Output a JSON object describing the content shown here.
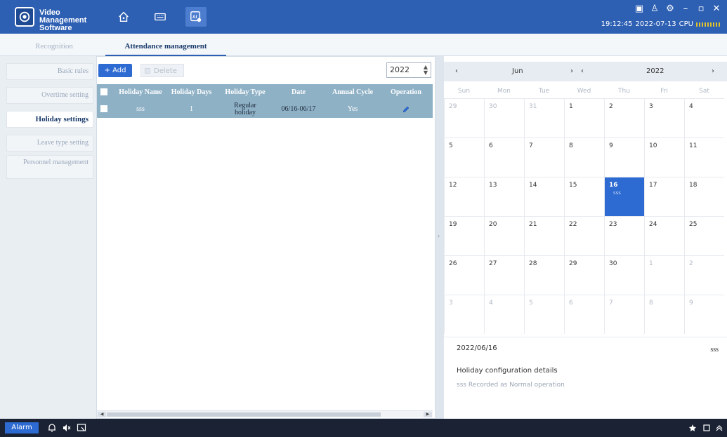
{
  "app": {
    "title": "Video Management Software",
    "nav_icons": [
      "home-icon",
      "keyboard-icon",
      "ai-icon"
    ],
    "window_controls": [
      "monitor-icon",
      "user-icon",
      "settings-icon",
      "minimize-icon",
      "maximize-icon",
      "close-icon"
    ],
    "time": "19:12:45",
    "date": "2022-07-13",
    "cpu_label": "CPU"
  },
  "tabs": [
    {
      "label": "Recognition",
      "active": false
    },
    {
      "label": "Attendance management",
      "active": true
    }
  ],
  "sidebar": {
    "items": [
      {
        "label": "Basic rules"
      },
      {
        "label": "Overtime setting"
      },
      {
        "label": "Holiday settings"
      },
      {
        "label": "Leave type setting"
      },
      {
        "label": "Personnel management"
      }
    ],
    "active_index": 2
  },
  "toolbar": {
    "add_label": "+ Add",
    "delete_label": "Delete",
    "year": "2022"
  },
  "table": {
    "columns": [
      "Holiday Name",
      "Holiday Days",
      "Holiday Type",
      "Date",
      "Annual Cycle",
      "Operation"
    ],
    "rows": [
      {
        "name": "sss",
        "days": "1",
        "type": "Regular holiday",
        "date": "06/16-06/17",
        "annual": "Yes"
      }
    ]
  },
  "calendar": {
    "prev_month": "‹",
    "month": "Jun",
    "next_month": "›",
    "prev_year": "‹",
    "year": "2022",
    "next_year": "›",
    "weekdays": [
      "Sun",
      "Mon",
      "Tue",
      "Wed",
      "Thu",
      "Fri",
      "Sat"
    ],
    "weeks": [
      [
        "29",
        "30",
        "31",
        "1",
        "2",
        "3",
        "4"
      ],
      [
        "5",
        "6",
        "7",
        "8",
        "9",
        "10",
        "11"
      ],
      [
        "12",
        "13",
        "14",
        "15",
        "16",
        "17",
        "18"
      ],
      [
        "19",
        "20",
        "21",
        "22",
        "23",
        "24",
        "25"
      ],
      [
        "26",
        "27",
        "28",
        "29",
        "30",
        "1",
        "2"
      ],
      [
        "3",
        "4",
        "5",
        "6",
        "7",
        "8",
        "9"
      ]
    ],
    "selected": {
      "week": 2,
      "day": 4,
      "event": "sss"
    }
  },
  "details": {
    "date": "2022/06/16",
    "tag": "sss",
    "title": "Holiday configuration details",
    "description": "sss Recorded as Normal operation"
  },
  "taskbar": {
    "alarm_label": "Alarm"
  }
}
